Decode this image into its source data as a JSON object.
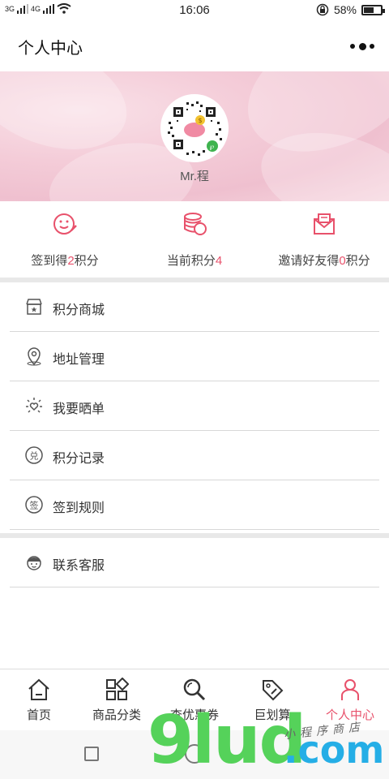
{
  "status_bar": {
    "signal_left": "3G",
    "signal_right": "4G",
    "time": "16:06",
    "battery": "58%",
    "battery_level": 0.58
  },
  "header": {
    "title": "个人中心"
  },
  "profile": {
    "username": "Mr.程"
  },
  "stats": [
    {
      "prefix": "签到得",
      "value": "2",
      "suffix": "积分",
      "icon": "smiley-pen-icon"
    },
    {
      "prefix": "当前积分",
      "value": "4",
      "suffix": "",
      "icon": "coin-stack-icon"
    },
    {
      "prefix": "邀请好友得",
      "value": "0",
      "suffix": "积分",
      "icon": "envelope-icon"
    }
  ],
  "menu_group_1": [
    {
      "label": "积分商城",
      "icon": "store-icon"
    },
    {
      "label": "地址管理",
      "icon": "location-icon"
    },
    {
      "label": "我要晒单",
      "icon": "sun-heart-icon"
    },
    {
      "label": "积分记录",
      "icon": "exchange-icon"
    },
    {
      "label": "签到规则",
      "icon": "sign-icon"
    }
  ],
  "menu_group_2": [
    {
      "label": "联系客服",
      "icon": "customer-service-icon"
    }
  ],
  "tabbar": [
    {
      "label": "首页",
      "icon": "home-icon",
      "active": false
    },
    {
      "label": "商品分类",
      "icon": "category-icon",
      "active": false
    },
    {
      "label": "查优惠券",
      "icon": "search-coupon-icon",
      "active": false
    },
    {
      "label": "巨划算",
      "icon": "tag-icon",
      "active": false
    },
    {
      "label": "个人中心",
      "icon": "person-icon",
      "active": true
    }
  ],
  "colors": {
    "accent": "#e8516b",
    "text": "#333333",
    "divider": "#d8d8d8"
  },
  "watermark": {
    "main": "9lud",
    "domain": ".com",
    "sub": "小程序商店"
  }
}
